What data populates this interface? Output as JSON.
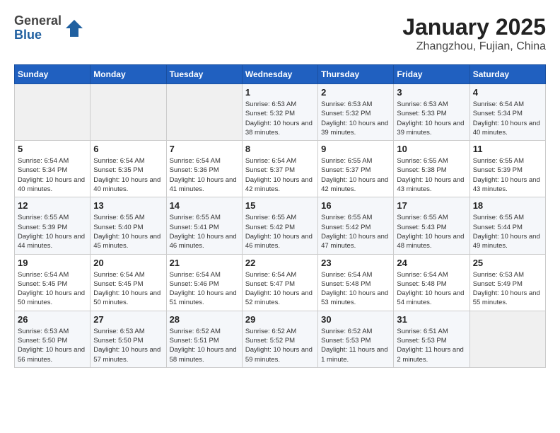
{
  "header": {
    "logo": {
      "general": "General",
      "blue": "Blue"
    },
    "title": "January 2025",
    "subtitle": "Zhangzhou, Fujian, China"
  },
  "days_of_week": [
    "Sunday",
    "Monday",
    "Tuesday",
    "Wednesday",
    "Thursday",
    "Friday",
    "Saturday"
  ],
  "weeks": [
    [
      {
        "day": null
      },
      {
        "day": null
      },
      {
        "day": null
      },
      {
        "day": 1,
        "sunrise": "Sunrise: 6:53 AM",
        "sunset": "Sunset: 5:32 PM",
        "daylight": "Daylight: 10 hours and 38 minutes."
      },
      {
        "day": 2,
        "sunrise": "Sunrise: 6:53 AM",
        "sunset": "Sunset: 5:32 PM",
        "daylight": "Daylight: 10 hours and 39 minutes."
      },
      {
        "day": 3,
        "sunrise": "Sunrise: 6:53 AM",
        "sunset": "Sunset: 5:33 PM",
        "daylight": "Daylight: 10 hours and 39 minutes."
      },
      {
        "day": 4,
        "sunrise": "Sunrise: 6:54 AM",
        "sunset": "Sunset: 5:34 PM",
        "daylight": "Daylight: 10 hours and 40 minutes."
      }
    ],
    [
      {
        "day": 5,
        "sunrise": "Sunrise: 6:54 AM",
        "sunset": "Sunset: 5:34 PM",
        "daylight": "Daylight: 10 hours and 40 minutes."
      },
      {
        "day": 6,
        "sunrise": "Sunrise: 6:54 AM",
        "sunset": "Sunset: 5:35 PM",
        "daylight": "Daylight: 10 hours and 40 minutes."
      },
      {
        "day": 7,
        "sunrise": "Sunrise: 6:54 AM",
        "sunset": "Sunset: 5:36 PM",
        "daylight": "Daylight: 10 hours and 41 minutes."
      },
      {
        "day": 8,
        "sunrise": "Sunrise: 6:54 AM",
        "sunset": "Sunset: 5:37 PM",
        "daylight": "Daylight: 10 hours and 42 minutes."
      },
      {
        "day": 9,
        "sunrise": "Sunrise: 6:55 AM",
        "sunset": "Sunset: 5:37 PM",
        "daylight": "Daylight: 10 hours and 42 minutes."
      },
      {
        "day": 10,
        "sunrise": "Sunrise: 6:55 AM",
        "sunset": "Sunset: 5:38 PM",
        "daylight": "Daylight: 10 hours and 43 minutes."
      },
      {
        "day": 11,
        "sunrise": "Sunrise: 6:55 AM",
        "sunset": "Sunset: 5:39 PM",
        "daylight": "Daylight: 10 hours and 43 minutes."
      }
    ],
    [
      {
        "day": 12,
        "sunrise": "Sunrise: 6:55 AM",
        "sunset": "Sunset: 5:39 PM",
        "daylight": "Daylight: 10 hours and 44 minutes."
      },
      {
        "day": 13,
        "sunrise": "Sunrise: 6:55 AM",
        "sunset": "Sunset: 5:40 PM",
        "daylight": "Daylight: 10 hours and 45 minutes."
      },
      {
        "day": 14,
        "sunrise": "Sunrise: 6:55 AM",
        "sunset": "Sunset: 5:41 PM",
        "daylight": "Daylight: 10 hours and 46 minutes."
      },
      {
        "day": 15,
        "sunrise": "Sunrise: 6:55 AM",
        "sunset": "Sunset: 5:42 PM",
        "daylight": "Daylight: 10 hours and 46 minutes."
      },
      {
        "day": 16,
        "sunrise": "Sunrise: 6:55 AM",
        "sunset": "Sunset: 5:42 PM",
        "daylight": "Daylight: 10 hours and 47 minutes."
      },
      {
        "day": 17,
        "sunrise": "Sunrise: 6:55 AM",
        "sunset": "Sunset: 5:43 PM",
        "daylight": "Daylight: 10 hours and 48 minutes."
      },
      {
        "day": 18,
        "sunrise": "Sunrise: 6:55 AM",
        "sunset": "Sunset: 5:44 PM",
        "daylight": "Daylight: 10 hours and 49 minutes."
      }
    ],
    [
      {
        "day": 19,
        "sunrise": "Sunrise: 6:54 AM",
        "sunset": "Sunset: 5:45 PM",
        "daylight": "Daylight: 10 hours and 50 minutes."
      },
      {
        "day": 20,
        "sunrise": "Sunrise: 6:54 AM",
        "sunset": "Sunset: 5:45 PM",
        "daylight": "Daylight: 10 hours and 50 minutes."
      },
      {
        "day": 21,
        "sunrise": "Sunrise: 6:54 AM",
        "sunset": "Sunset: 5:46 PM",
        "daylight": "Daylight: 10 hours and 51 minutes."
      },
      {
        "day": 22,
        "sunrise": "Sunrise: 6:54 AM",
        "sunset": "Sunset: 5:47 PM",
        "daylight": "Daylight: 10 hours and 52 minutes."
      },
      {
        "day": 23,
        "sunrise": "Sunrise: 6:54 AM",
        "sunset": "Sunset: 5:48 PM",
        "daylight": "Daylight: 10 hours and 53 minutes."
      },
      {
        "day": 24,
        "sunrise": "Sunrise: 6:54 AM",
        "sunset": "Sunset: 5:48 PM",
        "daylight": "Daylight: 10 hours and 54 minutes."
      },
      {
        "day": 25,
        "sunrise": "Sunrise: 6:53 AM",
        "sunset": "Sunset: 5:49 PM",
        "daylight": "Daylight: 10 hours and 55 minutes."
      }
    ],
    [
      {
        "day": 26,
        "sunrise": "Sunrise: 6:53 AM",
        "sunset": "Sunset: 5:50 PM",
        "daylight": "Daylight: 10 hours and 56 minutes."
      },
      {
        "day": 27,
        "sunrise": "Sunrise: 6:53 AM",
        "sunset": "Sunset: 5:50 PM",
        "daylight": "Daylight: 10 hours and 57 minutes."
      },
      {
        "day": 28,
        "sunrise": "Sunrise: 6:52 AM",
        "sunset": "Sunset: 5:51 PM",
        "daylight": "Daylight: 10 hours and 58 minutes."
      },
      {
        "day": 29,
        "sunrise": "Sunrise: 6:52 AM",
        "sunset": "Sunset: 5:52 PM",
        "daylight": "Daylight: 10 hours and 59 minutes."
      },
      {
        "day": 30,
        "sunrise": "Sunrise: 6:52 AM",
        "sunset": "Sunset: 5:53 PM",
        "daylight": "Daylight: 11 hours and 1 minute."
      },
      {
        "day": 31,
        "sunrise": "Sunrise: 6:51 AM",
        "sunset": "Sunset: 5:53 PM",
        "daylight": "Daylight: 11 hours and 2 minutes."
      },
      {
        "day": null
      }
    ]
  ]
}
